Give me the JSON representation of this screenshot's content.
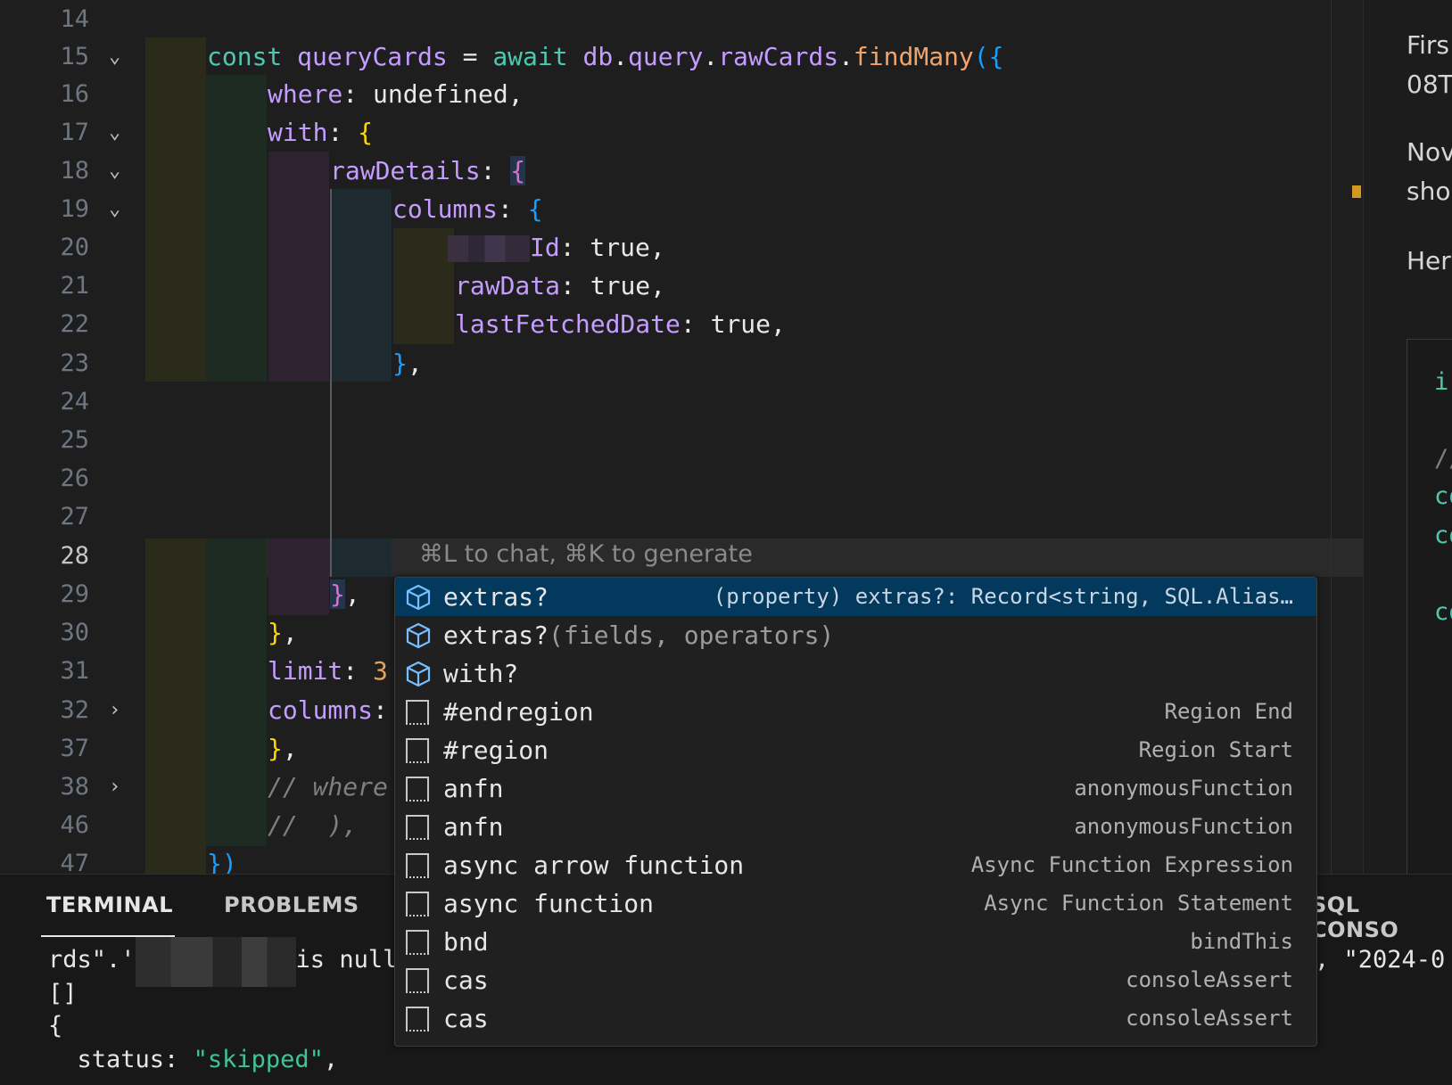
{
  "editor": {
    "line_numbers": [
      "14",
      "15",
      "16",
      "17",
      "18",
      "19",
      "20",
      "21",
      "22",
      "23",
      "24",
      "25",
      "26",
      "27",
      "28",
      "29",
      "30",
      "31",
      "32",
      "37",
      "38",
      "46",
      "47"
    ],
    "active_line": "28",
    "inline_hint": "⌘L to chat, ⌘K to generate",
    "code": {
      "l15": {
        "const": "const",
        "name": "queryCards",
        "eq": " = ",
        "await": "await",
        "db": "db",
        "dot1": ".",
        "query": "query",
        "dot2": ".",
        "raw": "rawCards",
        "dot3": ".",
        "find": "findMany",
        "open": "({"
      },
      "l16": {
        "key": "where",
        "rest": ": undefined,"
      },
      "l17": {
        "key": "with",
        "colon": ": ",
        "brace": "{"
      },
      "l18": {
        "key": "rawDetails",
        "colon": ": ",
        "brace": "{"
      },
      "l19": {
        "key": "columns",
        "colon": ": ",
        "brace": "{"
      },
      "l20": {
        "key": "Id",
        "rest": ": true,"
      },
      "l21": {
        "key": "rawData",
        "rest": ": true,"
      },
      "l22": {
        "key": "lastFetchedDate",
        "rest": ": true,"
      },
      "l23": {
        "brace": "}",
        "rest": ","
      },
      "l29": {
        "brace": "}",
        "rest": ","
      },
      "l30": {
        "brace": "}",
        "rest": ","
      },
      "l31": {
        "key": "limit",
        "colon": ": ",
        "num": "3"
      },
      "l32": {
        "key": "columns",
        "colon": ":"
      },
      "l37": {
        "brace": "}",
        "rest": ","
      },
      "l38": {
        "comment": "// where"
      },
      "l46": {
        "comment": "//  ),"
      },
      "l47": {
        "brace": "})"
      }
    }
  },
  "suggestions": [
    {
      "label": "extras?",
      "label_dim": "",
      "detail": "(property) extras?: Record<string, SQL.Alias…",
      "icon": "property-cube-icon",
      "selected": true
    },
    {
      "label": "extras?",
      "label_dim": "(fields, operators)",
      "detail": "",
      "icon": "property-cube-icon",
      "selected": false
    },
    {
      "label": "with?",
      "label_dim": "",
      "detail": "",
      "icon": "property-cube-icon",
      "selected": false
    },
    {
      "label": "#endregion",
      "label_dim": "",
      "detail": "Region End",
      "icon": "snippet-icon",
      "selected": false
    },
    {
      "label": "#region",
      "label_dim": "",
      "detail": "Region Start",
      "icon": "snippet-icon",
      "selected": false
    },
    {
      "label": "anfn",
      "label_dim": "",
      "detail": "anonymousFunction",
      "icon": "snippet-icon",
      "selected": false
    },
    {
      "label": "anfn",
      "label_dim": "",
      "detail": "anonymousFunction",
      "icon": "snippet-icon",
      "selected": false
    },
    {
      "label": "async arrow function",
      "label_dim": "",
      "detail": "Async Function Expression",
      "icon": "snippet-icon",
      "selected": false
    },
    {
      "label": "async function",
      "label_dim": "",
      "detail": "Async Function Statement",
      "icon": "snippet-icon",
      "selected": false
    },
    {
      "label": "bnd",
      "label_dim": "",
      "detail": "bindThis",
      "icon": "snippet-icon",
      "selected": false
    },
    {
      "label": "cas",
      "label_dim": "",
      "detail": "consoleAssert",
      "icon": "snippet-icon",
      "selected": false
    },
    {
      "label": "cas",
      "label_dim": "",
      "detail": "consoleAssert",
      "icon": "snippet-icon",
      "selected": false
    }
  ],
  "panel": {
    "tabs": {
      "terminal": "TERMINAL",
      "problems": "PROBLEMS",
      "sql_console": "SQL CONSO"
    },
    "terminal_lines": {
      "l1_a": "rds\".'",
      "l1_b": "is null",
      "l1_right": ", \"2024-0",
      "l2": "[]",
      "l3": "{",
      "l4_key": "  status",
      "l4_colon": ": ",
      "l4_val": "\"skipped\"",
      "l4_end": ","
    }
  },
  "right_panel": {
    "line1": "Firs",
    "line2": "08T",
    "line3": "Nov",
    "line4": "sho",
    "line5": "Her",
    "code1": "ir",
    "code2": "//",
    "code3": "co",
    "code4": "co",
    "code5": "co"
  },
  "colors": {
    "accent_selected": "#04395e",
    "scroll_marker": "#d29922",
    "string_green": "#3ec49a"
  }
}
